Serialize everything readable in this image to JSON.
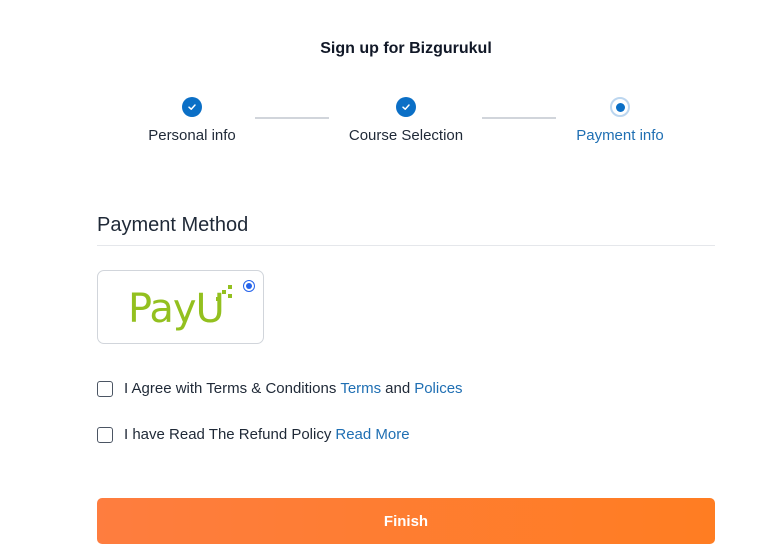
{
  "page_title": "Sign up for Bizgurukul",
  "stepper": {
    "steps": [
      {
        "label": "Personal info",
        "status": "completed"
      },
      {
        "label": "Course Selection",
        "status": "completed"
      },
      {
        "label": "Payment info",
        "status": "current"
      }
    ]
  },
  "payment": {
    "heading": "Payment Method",
    "options": [
      {
        "logo_text": "PayU",
        "selected": true,
        "logo_color": "#93c01f"
      }
    ]
  },
  "agreements": {
    "terms": {
      "text": "I Agree with Terms & Conditions",
      "link1": "Terms",
      "joiner": "and",
      "link2": "Polices",
      "checked": false
    },
    "refund": {
      "text": "I have Read The Refund Policy",
      "link": "Read More",
      "checked": false
    }
  },
  "finish_button": {
    "label": "Finish"
  },
  "colors": {
    "accent": "#0b6fc6",
    "link": "#1f6fb3",
    "button_start": "#fe7d3f",
    "button_end": "#ff7d22"
  }
}
